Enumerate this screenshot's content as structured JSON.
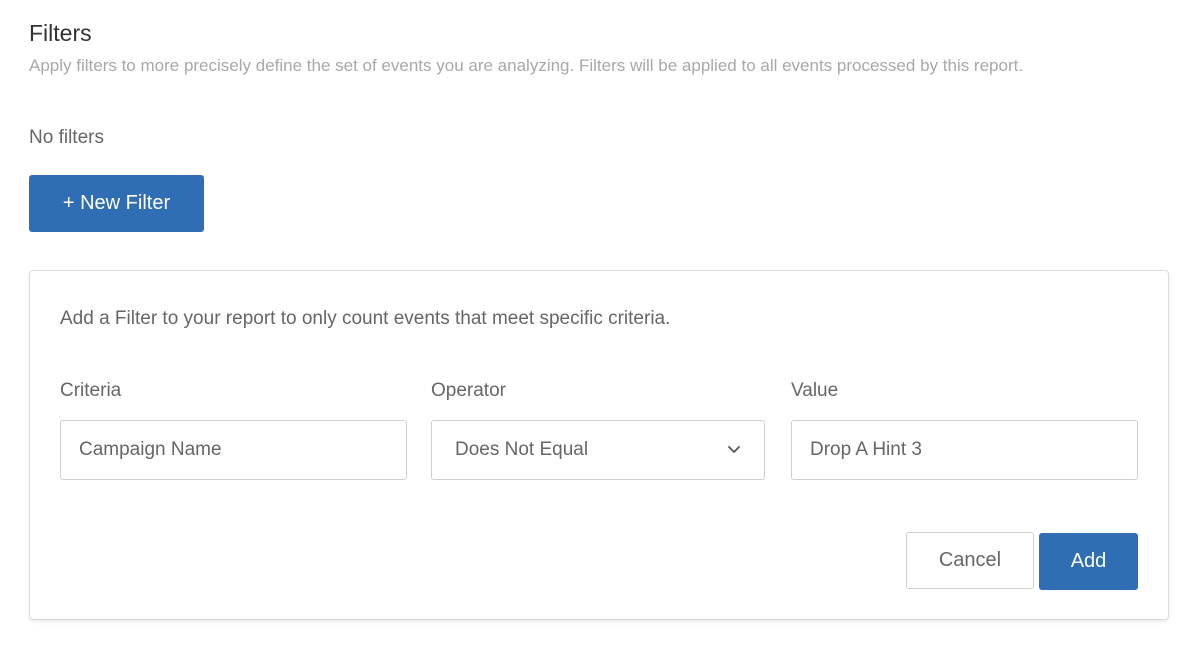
{
  "header": {
    "title": "Filters",
    "subtitle": "Apply filters to more precisely define the set of events you are analyzing. Filters will be applied to all events processed by this report."
  },
  "empty_state": "No filters",
  "new_filter_button": "+ New Filter",
  "panel": {
    "intro": "Add a Filter to your report to only count events that meet specific criteria.",
    "criteria": {
      "label": "Criteria",
      "value": "Campaign Name"
    },
    "operator": {
      "label": "Operator",
      "selected": "Does Not Equal",
      "icon": "chevron-down-icon"
    },
    "value": {
      "label": "Value",
      "value": "Drop A Hint 3"
    },
    "cancel_label": "Cancel",
    "add_label": "Add"
  },
  "colors": {
    "primary": "#2f6db5",
    "border": "#cfcfcf",
    "muted_text": "#a8a8a8"
  }
}
